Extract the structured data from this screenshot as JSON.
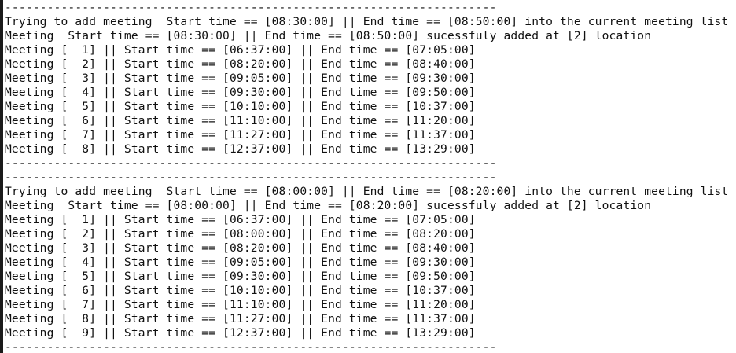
{
  "terminal": {
    "lines": [
      "----------------------------------------------------------------------",
      "Trying to add meeting  Start time == [08:30:00] || End time == [08:50:00] into the current meeting list",
      "Meeting  Start time == [08:30:00] || End time == [08:50:00] sucessfuly added at [2] location",
      "Meeting [  1] || Start time == [06:37:00] || End time == [07:05:00]",
      "Meeting [  2] || Start time == [08:20:00] || End time == [08:40:00]",
      "Meeting [  3] || Start time == [09:05:00] || End time == [09:30:00]",
      "Meeting [  4] || Start time == [09:30:00] || End time == [09:50:00]",
      "Meeting [  5] || Start time == [10:10:00] || End time == [10:37:00]",
      "Meeting [  6] || Start time == [11:10:00] || End time == [11:20:00]",
      "Meeting [  7] || Start time == [11:27:00] || End time == [11:37:00]",
      "Meeting [  8] || Start time == [12:37:00] || End time == [13:29:00]",
      "----------------------------------------------------------------------",
      "----------------------------------------------------------------------",
      "Trying to add meeting  Start time == [08:00:00] || End time == [08:20:00] into the current meeting list",
      "Meeting  Start time == [08:00:00] || End time == [08:20:00] sucessfuly added at [2] location",
      "Meeting [  1] || Start time == [06:37:00] || End time == [07:05:00]",
      "Meeting [  2] || Start time == [08:00:00] || End time == [08:20:00]",
      "Meeting [  3] || Start time == [08:20:00] || End time == [08:40:00]",
      "Meeting [  4] || Start time == [09:05:00] || End time == [09:30:00]",
      "Meeting [  5] || Start time == [09:30:00] || End time == [09:50:00]",
      "Meeting [  6] || Start time == [10:10:00] || End time == [10:37:00]",
      "Meeting [  7] || Start time == [11:10:00] || End time == [11:20:00]",
      "Meeting [  8] || Start time == [11:27:00] || End time == [11:37:00]",
      "Meeting [  9] || Start time == [12:37:00] || End time == [13:29:00]",
      "----------------------------------------------------------------------"
    ]
  }
}
